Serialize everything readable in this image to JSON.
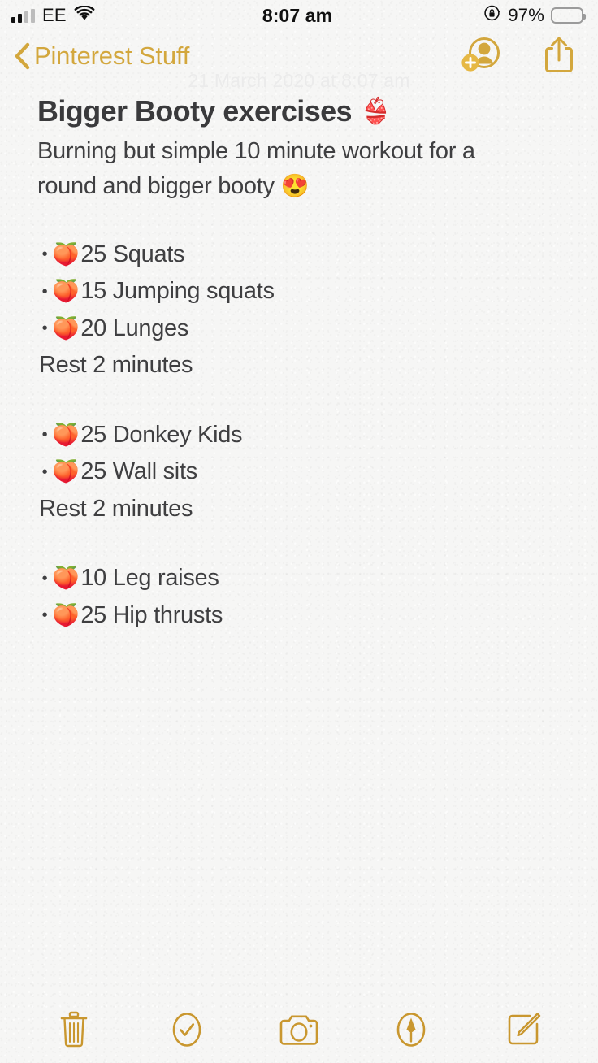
{
  "status_bar": {
    "carrier": "EE",
    "time": "8:07 am",
    "battery_percent": "97%",
    "battery_level": 97,
    "signal_bars_filled": 2,
    "signal_bars_total": 4,
    "icons": [
      "signal-bars-icon",
      "wifi-icon",
      "rotation-lock-icon",
      "battery-icon"
    ],
    "battery_color": "#efc53f"
  },
  "nav_bar": {
    "back_label": "Pinterest Stuff",
    "back_icon": "chevron-left-icon",
    "accent_color": "#d3a73d",
    "actions": [
      {
        "name": "add-person-button",
        "icon": "add-person-icon"
      },
      {
        "name": "share-button",
        "icon": "share-icon"
      }
    ]
  },
  "note": {
    "date_stamp": "21 March 2020 at 8:07 am",
    "title": "Bigger Booty exercises",
    "title_emoji": "👙",
    "subtitle": "Burning but simple 10 minute workout for a round and bigger booty",
    "subtitle_emoji": "😍",
    "bullet_emoji": "🍑",
    "bullet_marker": "•",
    "text_color": "#3f3f41",
    "blocks": [
      {
        "items": [
          {
            "emoji": "🍑",
            "text": "25 Squats"
          },
          {
            "emoji": "🍑",
            "text": "15 Jumping squats"
          },
          {
            "emoji": "🍑",
            "text": "20 Lunges"
          }
        ],
        "footer": "Rest 2 minutes"
      },
      {
        "items": [
          {
            "emoji": "🍑",
            "text": "25 Donkey Kids"
          },
          {
            "emoji": "🍑",
            "text": "25 Wall sits"
          }
        ],
        "footer": "Rest 2 minutes"
      },
      {
        "items": [
          {
            "emoji": "🍑",
            "text": "10 Leg raises"
          },
          {
            "emoji": "🍑",
            "text": "25 Hip thrusts"
          }
        ],
        "footer": ""
      }
    ]
  },
  "bottom_toolbar": {
    "accent_color": "#c9972f",
    "buttons": [
      {
        "name": "delete-button",
        "icon": "trash-icon"
      },
      {
        "name": "checklist-button",
        "icon": "checkmark-circle-icon"
      },
      {
        "name": "camera-button",
        "icon": "camera-icon"
      },
      {
        "name": "markup-button",
        "icon": "markup-pen-circle-icon"
      },
      {
        "name": "compose-button",
        "icon": "compose-icon"
      }
    ]
  }
}
